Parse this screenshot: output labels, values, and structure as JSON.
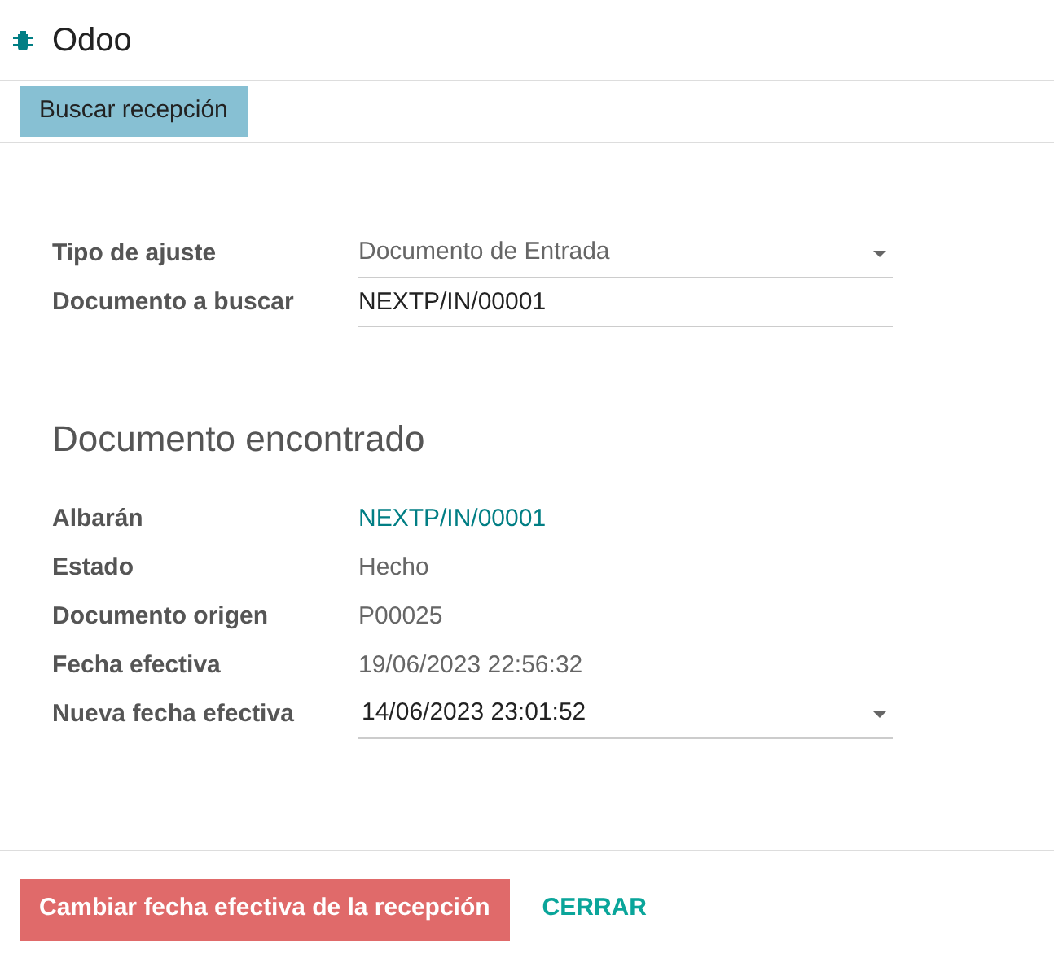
{
  "window": {
    "title": "Odoo"
  },
  "toolbar": {
    "button": "Buscar recepción"
  },
  "search": [
    {
      "label": "Tipo de ajuste",
      "kind": "select",
      "value": "Documento de Entrada"
    },
    {
      "label": "Documento a buscar",
      "kind": "input",
      "value": "NEXTP/IN/00001"
    }
  ],
  "found": {
    "heading": "Documento encontrado",
    "rows": [
      {
        "label": "Albarán",
        "kind": "link",
        "value": "NEXTP/IN/00001"
      },
      {
        "label": "Estado",
        "kind": "text",
        "value": "Hecho"
      },
      {
        "label": "Documento origen",
        "kind": "text",
        "value": "P00025"
      },
      {
        "label": "Fecha efectiva",
        "kind": "text",
        "value": "19/06/2023 22:56:32"
      },
      {
        "label": "Nueva fecha efectiva",
        "kind": "select",
        "value": "14/06/2023 23:01:52"
      }
    ]
  },
  "footer": {
    "primary": "Cambiar fecha efectiva de la recepción",
    "secondary": "CERRAR"
  }
}
